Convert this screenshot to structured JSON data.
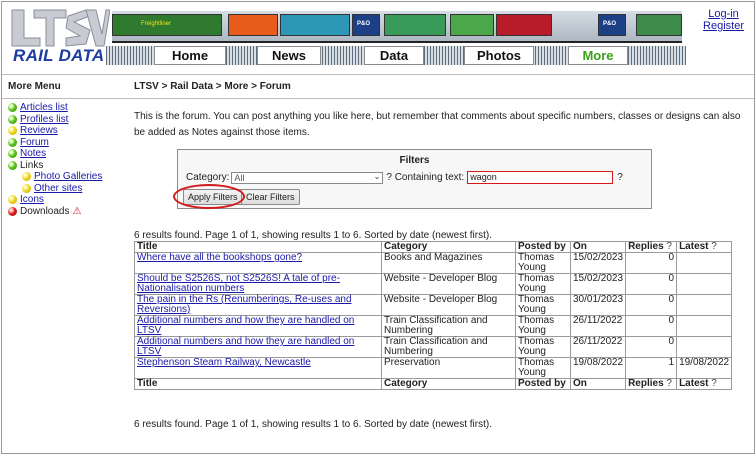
{
  "header": {
    "logo_top": "LTSV",
    "logo_bottom": "RAIL DATA",
    "nav": [
      "Home",
      "News",
      "Data",
      "Photos",
      "More"
    ],
    "active": "More",
    "login": "Log-in",
    "register": "Register",
    "train_labels": [
      "Freightliner",
      "P&O",
      "P&O"
    ]
  },
  "sidebar": {
    "title": "More Menu",
    "items": [
      {
        "label": "Articles list",
        "dot": "green",
        "link": true,
        "sub": false
      },
      {
        "label": "Profiles list",
        "dot": "green",
        "link": true,
        "sub": false
      },
      {
        "label": "Reviews",
        "dot": "yellow",
        "link": true,
        "sub": false
      },
      {
        "label": "Forum",
        "dot": "green",
        "link": true,
        "sub": false
      },
      {
        "label": "Notes",
        "dot": "green",
        "link": true,
        "sub": false
      },
      {
        "label": "Links",
        "dot": "green",
        "link": false,
        "sub": false
      },
      {
        "label": "Photo Galleries",
        "dot": "yellow",
        "link": true,
        "sub": true
      },
      {
        "label": "Other sites",
        "dot": "yellow",
        "link": true,
        "sub": true
      },
      {
        "label": "Icons",
        "dot": "yellow",
        "link": true,
        "sub": false
      },
      {
        "label": "Downloads",
        "dot": "red",
        "link": false,
        "sub": false,
        "warning": true
      }
    ]
  },
  "main": {
    "breadcrumb": "LTSV > Rail Data > More > Forum",
    "intro": "This is the forum. You can post anything you like here, but remember that comments about specific numbers, classes or designs can also be added as Notes against those items.",
    "filters": {
      "title": "Filters",
      "category_label": "Category:",
      "category_value": "All",
      "text_label": "? Containing text:",
      "text_value": "wagon",
      "help": "?",
      "apply": "Apply Filters",
      "clear": "Clear Filters"
    },
    "summary": "6 results found. Page 1 of 1, showing results 1 to 6. Sorted by date (newest first).",
    "columns": [
      "Title",
      "Category",
      "Posted by",
      "On",
      "Replies",
      "Latest"
    ],
    "rows": [
      {
        "title": "Where have all the bookshops gone?",
        "category": "Books and Magazines",
        "posted_by": "Thomas Young",
        "on": "15/02/2023",
        "replies": "0",
        "latest": ""
      },
      {
        "title": "Should be S2526S, not S2526S! A tale of pre-Nationalisation numbers",
        "category": "Website - Developer Blog",
        "posted_by": "Thomas Young",
        "on": "15/02/2023",
        "replies": "0",
        "latest": ""
      },
      {
        "title": "The pain in the Rs (Renumberings, Re-uses and Reversions)",
        "category": "Website - Developer Blog",
        "posted_by": "Thomas Young",
        "on": "30/01/2023",
        "replies": "0",
        "latest": ""
      },
      {
        "title": "Additional numbers and how they are handled on LTSV",
        "category": "Train Classification and Numbering",
        "posted_by": "Thomas Young",
        "on": "26/11/2022",
        "replies": "0",
        "latest": ""
      },
      {
        "title": "Additional numbers and how they are handled on LTSV",
        "category": "Train Classification and Numbering",
        "posted_by": "Thomas Young",
        "on": "26/11/2022",
        "replies": "0",
        "latest": ""
      },
      {
        "title": "Stephenson Steam Railway, Newcastle",
        "category": "Preservation",
        "posted_by": "Thomas Young",
        "on": "19/08/2022",
        "replies": "1",
        "latest": "19/08/2022"
      }
    ]
  }
}
